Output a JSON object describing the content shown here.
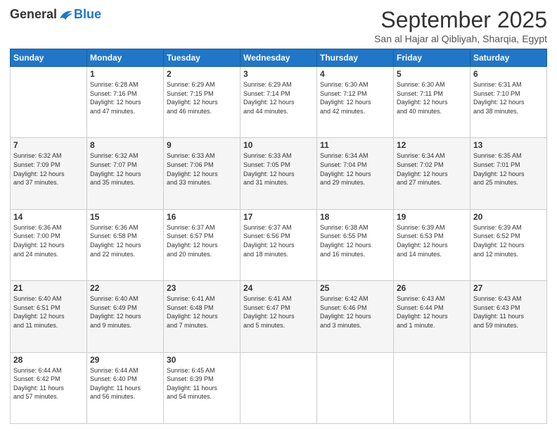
{
  "logo": {
    "general": "General",
    "blue": "Blue"
  },
  "header": {
    "title": "September 2025",
    "location": "San al Hajar al Qibliyah, Sharqia, Egypt"
  },
  "days_of_week": [
    "Sunday",
    "Monday",
    "Tuesday",
    "Wednesday",
    "Thursday",
    "Friday",
    "Saturday"
  ],
  "weeks": [
    [
      {
        "day": "",
        "info": ""
      },
      {
        "day": "1",
        "info": "Sunrise: 6:28 AM\nSunset: 7:16 PM\nDaylight: 12 hours\nand 47 minutes."
      },
      {
        "day": "2",
        "info": "Sunrise: 6:29 AM\nSunset: 7:15 PM\nDaylight: 12 hours\nand 46 minutes."
      },
      {
        "day": "3",
        "info": "Sunrise: 6:29 AM\nSunset: 7:14 PM\nDaylight: 12 hours\nand 44 minutes."
      },
      {
        "day": "4",
        "info": "Sunrise: 6:30 AM\nSunset: 7:12 PM\nDaylight: 12 hours\nand 42 minutes."
      },
      {
        "day": "5",
        "info": "Sunrise: 6:30 AM\nSunset: 7:11 PM\nDaylight: 12 hours\nand 40 minutes."
      },
      {
        "day": "6",
        "info": "Sunrise: 6:31 AM\nSunset: 7:10 PM\nDaylight: 12 hours\nand 38 minutes."
      }
    ],
    [
      {
        "day": "7",
        "info": "Sunrise: 6:32 AM\nSunset: 7:09 PM\nDaylight: 12 hours\nand 37 minutes."
      },
      {
        "day": "8",
        "info": "Sunrise: 6:32 AM\nSunset: 7:07 PM\nDaylight: 12 hours\nand 35 minutes."
      },
      {
        "day": "9",
        "info": "Sunrise: 6:33 AM\nSunset: 7:06 PM\nDaylight: 12 hours\nand 33 minutes."
      },
      {
        "day": "10",
        "info": "Sunrise: 6:33 AM\nSunset: 7:05 PM\nDaylight: 12 hours\nand 31 minutes."
      },
      {
        "day": "11",
        "info": "Sunrise: 6:34 AM\nSunset: 7:04 PM\nDaylight: 12 hours\nand 29 minutes."
      },
      {
        "day": "12",
        "info": "Sunrise: 6:34 AM\nSunset: 7:02 PM\nDaylight: 12 hours\nand 27 minutes."
      },
      {
        "day": "13",
        "info": "Sunrise: 6:35 AM\nSunset: 7:01 PM\nDaylight: 12 hours\nand 25 minutes."
      }
    ],
    [
      {
        "day": "14",
        "info": "Sunrise: 6:36 AM\nSunset: 7:00 PM\nDaylight: 12 hours\nand 24 minutes."
      },
      {
        "day": "15",
        "info": "Sunrise: 6:36 AM\nSunset: 6:58 PM\nDaylight: 12 hours\nand 22 minutes."
      },
      {
        "day": "16",
        "info": "Sunrise: 6:37 AM\nSunset: 6:57 PM\nDaylight: 12 hours\nand 20 minutes."
      },
      {
        "day": "17",
        "info": "Sunrise: 6:37 AM\nSunset: 6:56 PM\nDaylight: 12 hours\nand 18 minutes."
      },
      {
        "day": "18",
        "info": "Sunrise: 6:38 AM\nSunset: 6:55 PM\nDaylight: 12 hours\nand 16 minutes."
      },
      {
        "day": "19",
        "info": "Sunrise: 6:39 AM\nSunset: 6:53 PM\nDaylight: 12 hours\nand 14 minutes."
      },
      {
        "day": "20",
        "info": "Sunrise: 6:39 AM\nSunset: 6:52 PM\nDaylight: 12 hours\nand 12 minutes."
      }
    ],
    [
      {
        "day": "21",
        "info": "Sunrise: 6:40 AM\nSunset: 6:51 PM\nDaylight: 12 hours\nand 11 minutes."
      },
      {
        "day": "22",
        "info": "Sunrise: 6:40 AM\nSunset: 6:49 PM\nDaylight: 12 hours\nand 9 minutes."
      },
      {
        "day": "23",
        "info": "Sunrise: 6:41 AM\nSunset: 6:48 PM\nDaylight: 12 hours\nand 7 minutes."
      },
      {
        "day": "24",
        "info": "Sunrise: 6:41 AM\nSunset: 6:47 PM\nDaylight: 12 hours\nand 5 minutes."
      },
      {
        "day": "25",
        "info": "Sunrise: 6:42 AM\nSunset: 6:46 PM\nDaylight: 12 hours\nand 3 minutes."
      },
      {
        "day": "26",
        "info": "Sunrise: 6:43 AM\nSunset: 6:44 PM\nDaylight: 12 hours\nand 1 minute."
      },
      {
        "day": "27",
        "info": "Sunrise: 6:43 AM\nSunset: 6:43 PM\nDaylight: 11 hours\nand 59 minutes."
      }
    ],
    [
      {
        "day": "28",
        "info": "Sunrise: 6:44 AM\nSunset: 6:42 PM\nDaylight: 11 hours\nand 57 minutes."
      },
      {
        "day": "29",
        "info": "Sunrise: 6:44 AM\nSunset: 6:40 PM\nDaylight: 11 hours\nand 56 minutes."
      },
      {
        "day": "30",
        "info": "Sunrise: 6:45 AM\nSunset: 6:39 PM\nDaylight: 11 hours\nand 54 minutes."
      },
      {
        "day": "",
        "info": ""
      },
      {
        "day": "",
        "info": ""
      },
      {
        "day": "",
        "info": ""
      },
      {
        "day": "",
        "info": ""
      }
    ]
  ]
}
